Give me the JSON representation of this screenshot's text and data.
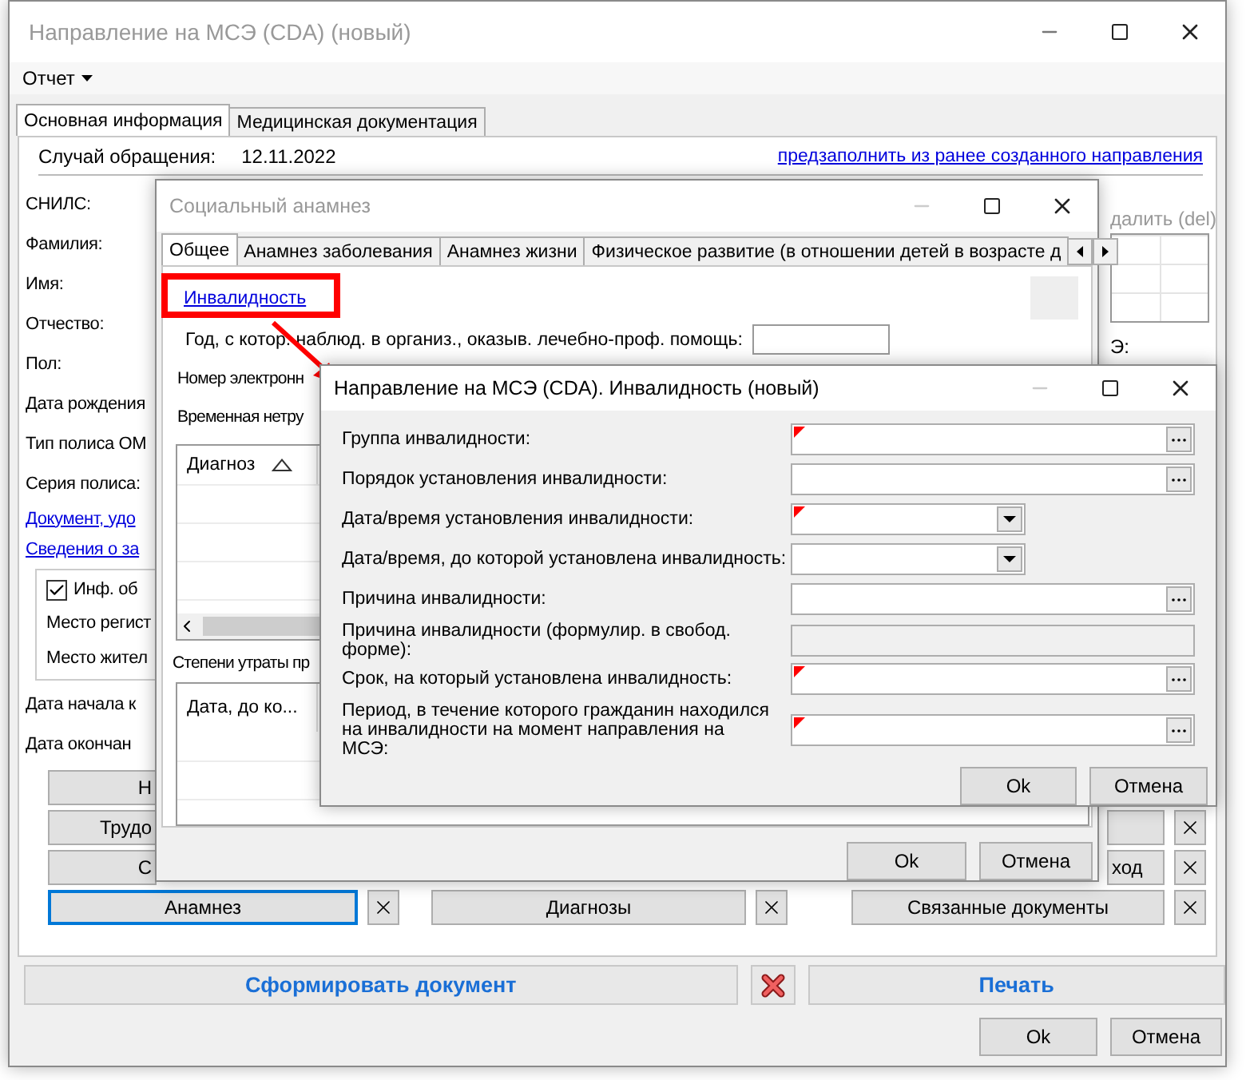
{
  "main_window": {
    "title": "Направление на МСЭ (CDA) (новый)",
    "menu": [
      {
        "label": "Отчет"
      }
    ],
    "tabs": [
      {
        "label": "Основная информация",
        "selected": true
      },
      {
        "label": "Медицинская документация",
        "selected": false
      }
    ],
    "case_label": "Случай обращения:",
    "case_date": "12.11.2022",
    "prefill_link": "предзаполнить из ранее созданного направления",
    "left_items": [
      {
        "kind": "label",
        "text": "СНИЛС:"
      },
      {
        "kind": "label",
        "text": "Фамилия:"
      },
      {
        "kind": "label",
        "text": "Имя:"
      },
      {
        "kind": "label",
        "text": "Отчество:"
      },
      {
        "kind": "label",
        "text": "Пол:"
      },
      {
        "kind": "label",
        "text": "Дата рождения"
      },
      {
        "kind": "label",
        "text": "Тип полиса ОМ"
      },
      {
        "kind": "label",
        "text": "Серия полиса:"
      },
      {
        "kind": "link",
        "text": "Документ, удо"
      },
      {
        "kind": "link",
        "text": "Сведения о за"
      },
      {
        "kind": "group",
        "checkbox": {
          "label": "Инф. об",
          "checked": true
        },
        "labels": [
          "Место регист",
          "Место жител"
        ]
      },
      {
        "kind": "label",
        "text": "Дата начала к"
      },
      {
        "kind": "label",
        "text": "Дата окончан"
      }
    ],
    "delete_label": "далить (del)",
    "side_label": "Э:",
    "button_rows": [
      {
        "left": {
          "label": "Н",
          "focused": false
        }
      },
      {
        "left": {
          "label": "Трудо",
          "focused": false
        },
        "right": {
          "close": true
        }
      },
      {
        "left": {
          "label": "С",
          "focused": false
        },
        "right": {
          "label": "ход",
          "close": true
        }
      },
      {
        "left": {
          "label": "Анамнез",
          "focused": true,
          "close": true
        },
        "middle": {
          "label": "Диагнозы",
          "close": true
        },
        "right": {
          "label": "Связанные документы",
          "close": true
        }
      }
    ],
    "generate_button": "Сформировать документ",
    "print_button": "Печать",
    "buttons": [
      "Ok",
      "Отмена"
    ]
  },
  "social_window": {
    "title": "Социальный анамнез",
    "tabs": [
      {
        "label": "Общее",
        "selected": true
      },
      {
        "label": "Анамнез заболевания",
        "selected": false
      },
      {
        "label": "Анамнез жизни",
        "selected": false
      },
      {
        "label": "Физическое развитие (в отношении детей в возрасте д",
        "selected": false
      }
    ],
    "disability_link": "Инвалидность",
    "year_label": "Год, с котор. наблюд. в организ., оказыв. лечебно-проф. помощь:",
    "labels": [
      "Номер электронн",
      "Временная нетру"
    ],
    "table_1": {
      "columns": [
        "Диагноз"
      ]
    },
    "loss_label": "Степени утраты пр",
    "table_2": {
      "columns": [
        "Дата, до ко..."
      ]
    },
    "buttons": [
      "Ok",
      "Отмена"
    ]
  },
  "dialog": {
    "title": "Направление на МСЭ (CDA). Инвалидность (новый)",
    "fields": [
      {
        "label": "Группа инвалидности:",
        "kind": "lookup",
        "required": true
      },
      {
        "label": "Порядок установления инвалидности:",
        "kind": "lookup",
        "required": false
      },
      {
        "label": "Дата/время установления инвалидности:",
        "kind": "date",
        "required": true
      },
      {
        "label": "Дата/время, до которой установлена инвалидность:",
        "kind": "date",
        "required": false
      },
      {
        "label": "Причина инвалидности:",
        "kind": "lookup",
        "required": false
      },
      {
        "label": "Причина инвалидности (формулир. в свобод. форме):",
        "kind": "disabled",
        "required": false
      },
      {
        "label": "Срок, на который установлена инвалидность:",
        "kind": "lookup",
        "required": true
      },
      {
        "label": "Период, в течение которого гражданин находился на инвалидности на момент направления на МСЭ:",
        "kind": "lookup",
        "required": true
      }
    ],
    "buttons": [
      "Ok",
      "Отмена"
    ]
  }
}
